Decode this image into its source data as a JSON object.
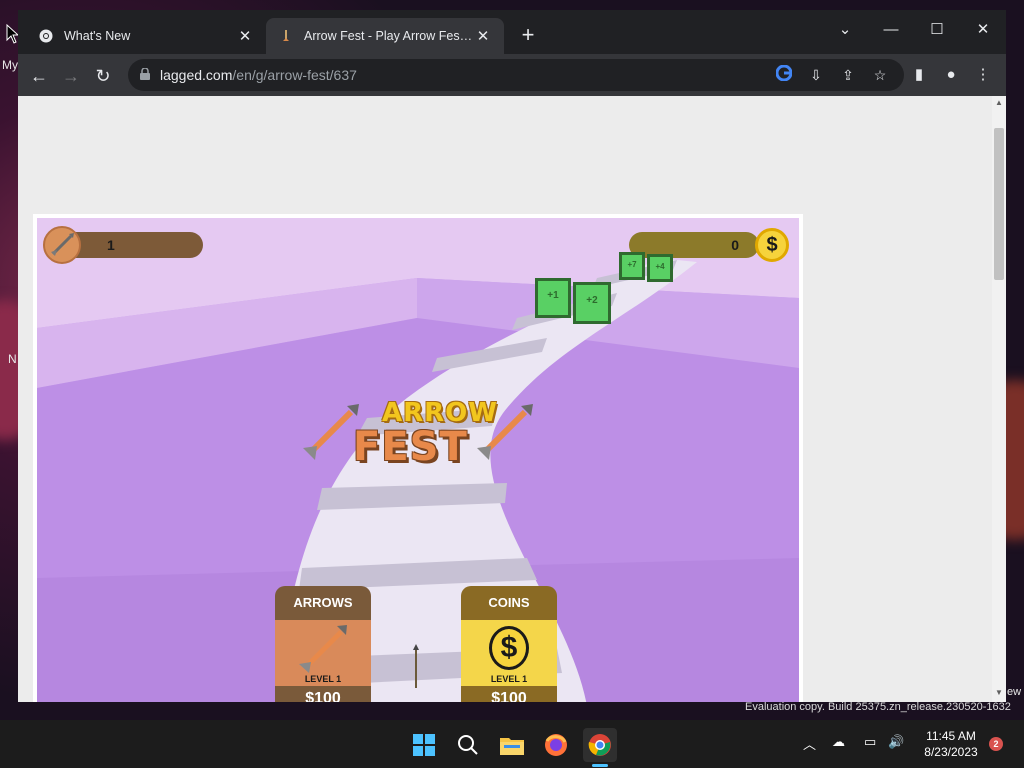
{
  "desktop": {
    "labels": [
      "My",
      "N"
    ],
    "watermark": "Evaluation copy. Build 25375.zn_release.230520-1632",
    "side_text": "ew"
  },
  "browser": {
    "tabs": [
      {
        "title": "What's New",
        "icon": "chrome-icon",
        "active": false
      },
      {
        "title": "Arrow Fest - Play Arrow Fest Game Online",
        "icon": "arrow-fest-icon",
        "active": true
      }
    ],
    "url_host": "lagged.com",
    "url_path": "/en/g/arrow-fest/637"
  },
  "game": {
    "arrow_count": "1",
    "coin_count": "0",
    "coin_symbol": "$",
    "logo_line1": "ARROW",
    "logo_line2": "FEST",
    "gates": [
      "+1",
      "+2",
      "+7",
      "+4"
    ],
    "cards": [
      {
        "title": "ARROWS",
        "level": "LEVEL 1",
        "price": "$100"
      },
      {
        "title": "COINS",
        "level": "LEVEL 1",
        "price": "$100"
      }
    ]
  },
  "taskbar": {
    "time": "11:45 AM",
    "date": "8/23/2023",
    "notifications": "2"
  },
  "colors": {
    "accent": "#8ab4f8",
    "game_bg": "#c39ae8",
    "gate_green": "#59d064"
  }
}
